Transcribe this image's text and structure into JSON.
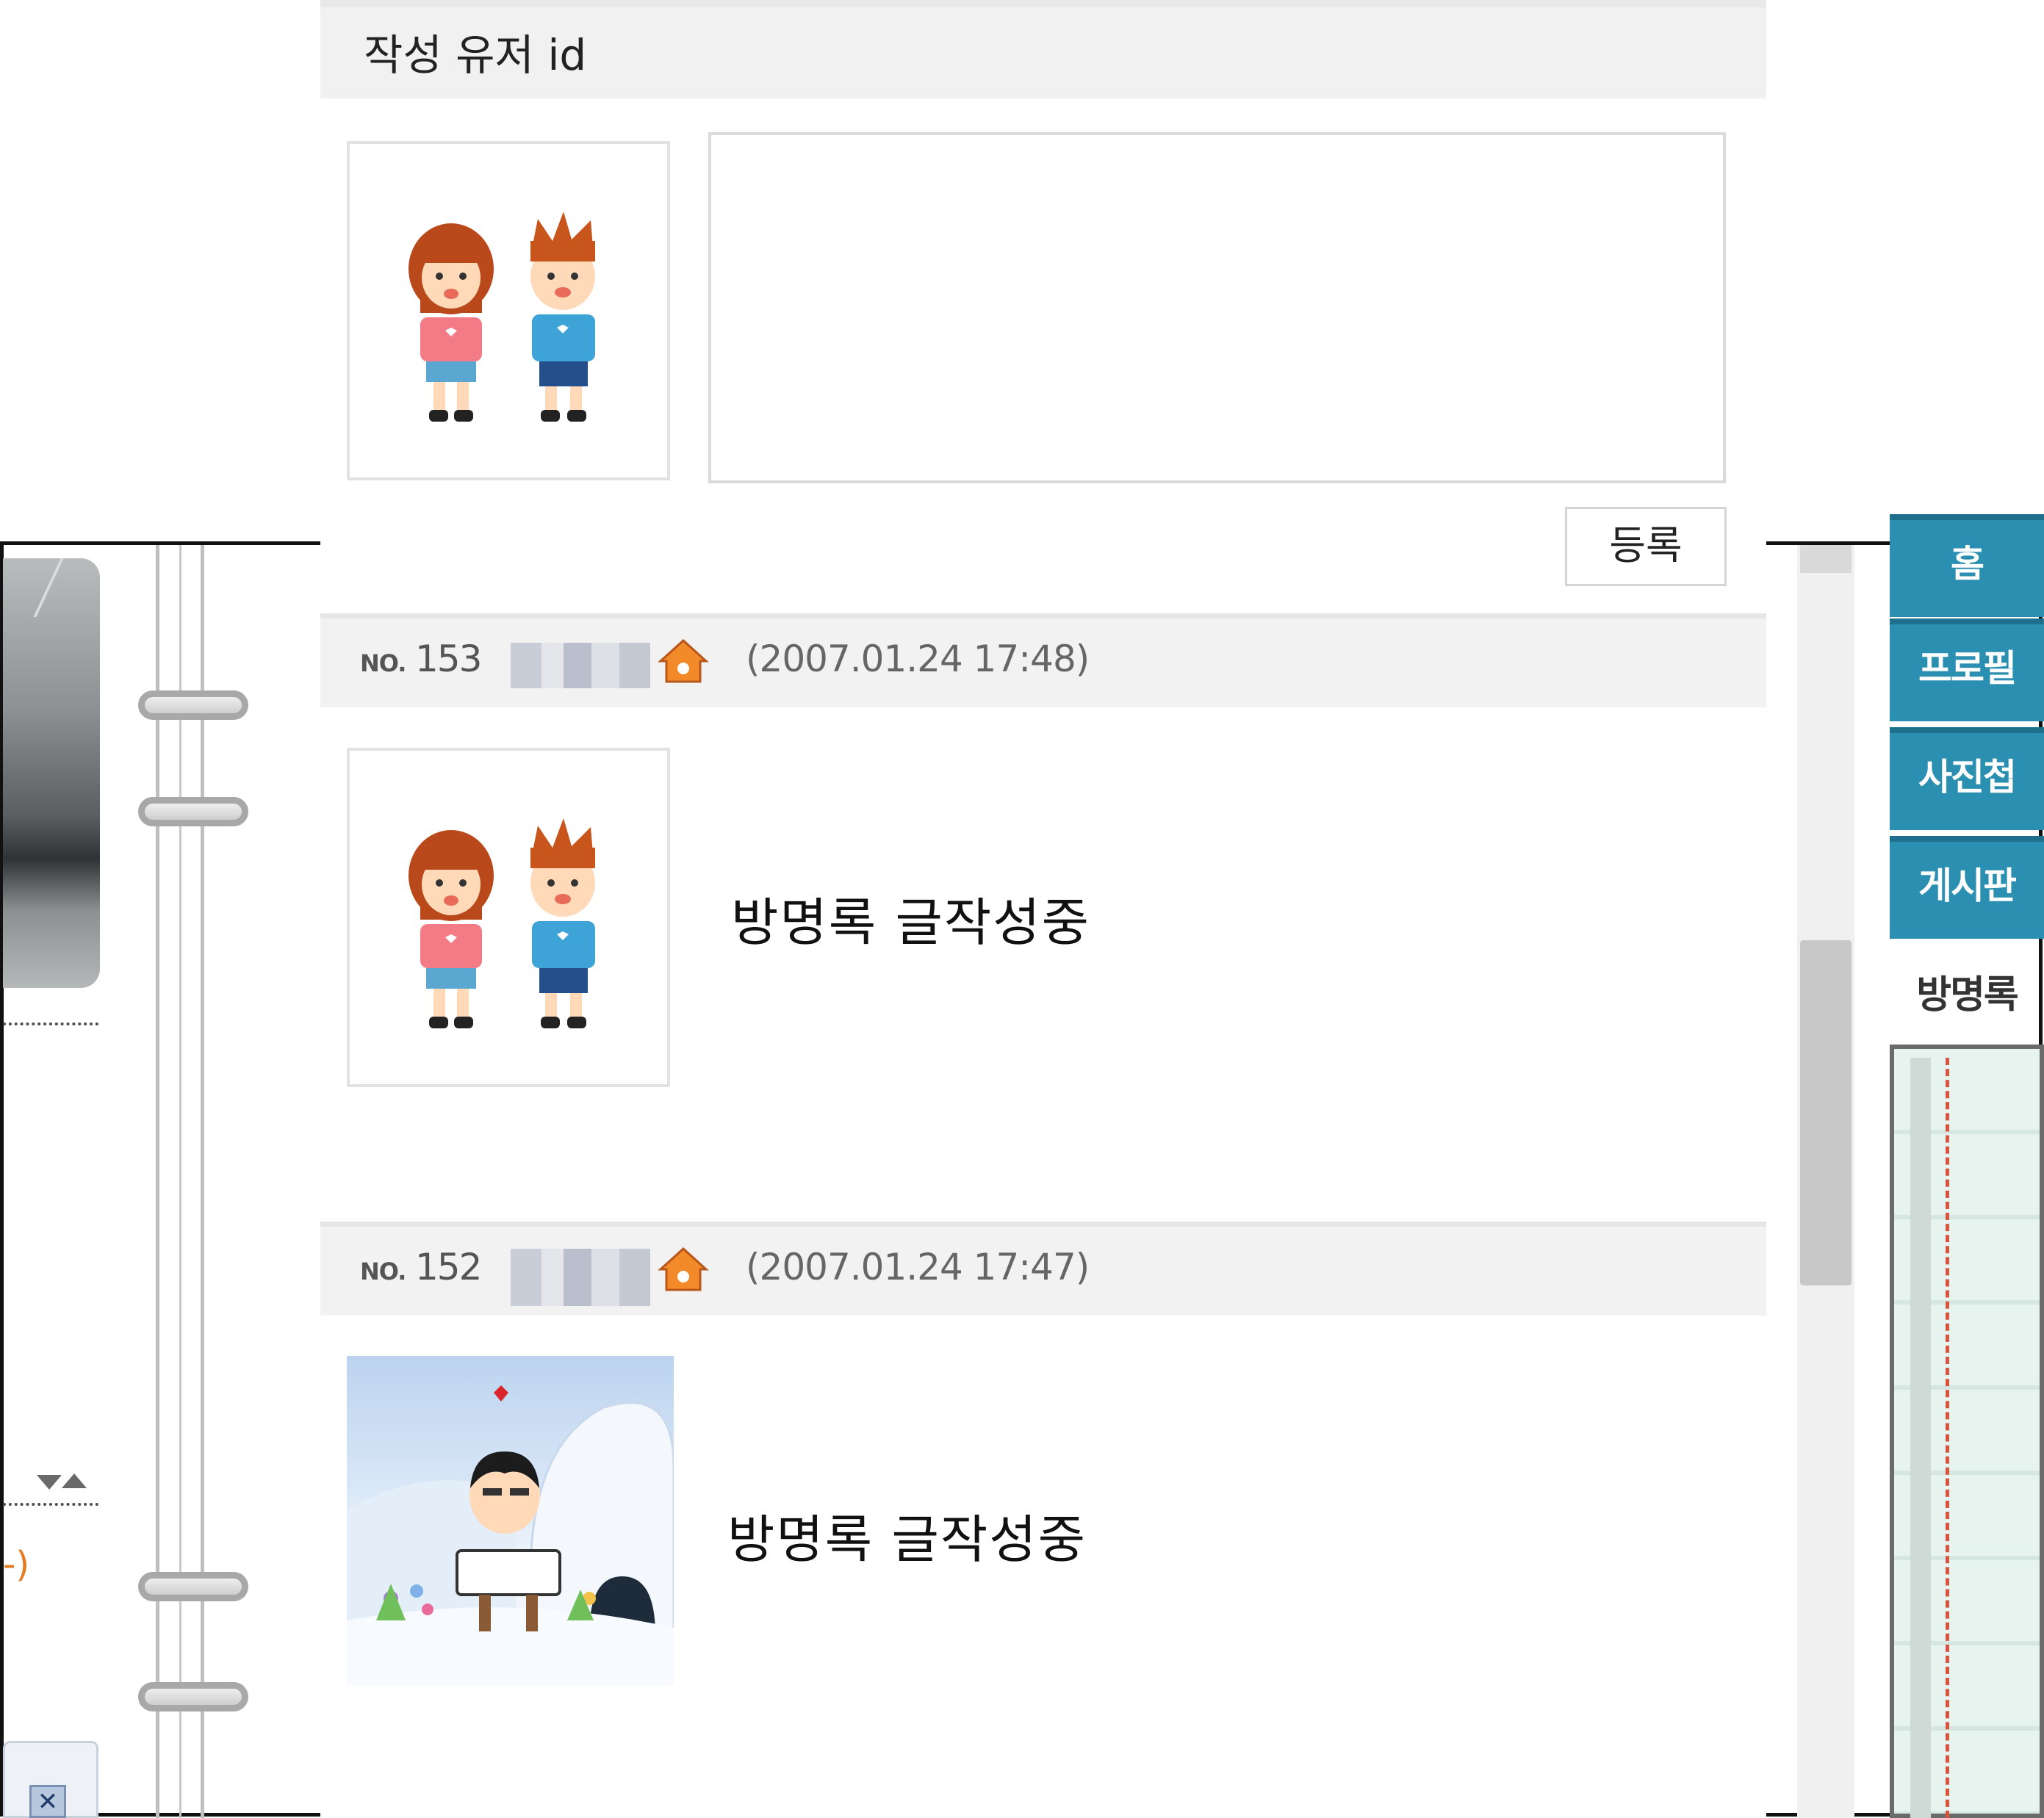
{
  "compose": {
    "author_label": "작성 유저 id",
    "message_value": "",
    "submit_label": "등록"
  },
  "entries": [
    {
      "no_prefix": "NO.",
      "number": "153",
      "date": "(2007.01.24 17:48)",
      "message": "방명록 글작성중",
      "avatar": "couple-avatar"
    },
    {
      "no_prefix": "NO.",
      "number": "152",
      "date": "(2007.01.24 17:47)",
      "message": "방명록 글작성중",
      "avatar": "igloo-avatar"
    }
  ],
  "minihome_menu": {
    "tabs": [
      "홈",
      "프로필",
      "사진첩",
      "게시판"
    ],
    "active_tab": "방명록"
  },
  "colors": {
    "tab_blue": "#2a8fb0",
    "entry_bar": "#f2f2f2",
    "header_bar": "#f1f1f1",
    "home_icon_orange": "#f28a2a"
  }
}
